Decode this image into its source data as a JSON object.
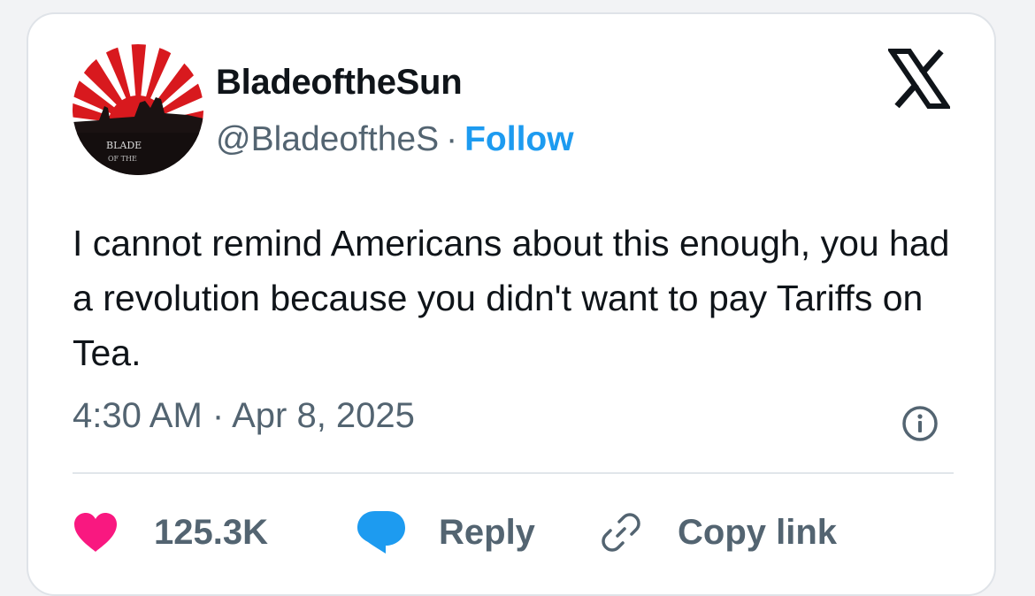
{
  "tweet": {
    "display_name": "BladeoftheSun",
    "handle": "@BladeoftheS",
    "separator": "·",
    "follow_label": "Follow",
    "text": "I cannot remind Americans about this enough, you had a revolution because you didn't want to pay Tariffs on Tea.",
    "timestamp": "4:30 AM · Apr 8, 2025",
    "avatar_text_line1": "BLADE",
    "avatar_text_line2": "OF THE"
  },
  "actions": {
    "like_count": "125.3K",
    "reply_label": "Reply",
    "copy_link_label": "Copy link"
  },
  "icons": {
    "brand": "x-logo-icon",
    "info": "info-icon",
    "like": "heart-icon",
    "reply": "speech-bubble-icon",
    "copy": "link-icon"
  },
  "colors": {
    "follow": "#1d9bf0",
    "heart": "#f91880",
    "reply_bubble": "#1d9bf0",
    "text_primary": "#0f1419",
    "text_secondary": "#536471",
    "avatar_red": "#d8191e"
  }
}
